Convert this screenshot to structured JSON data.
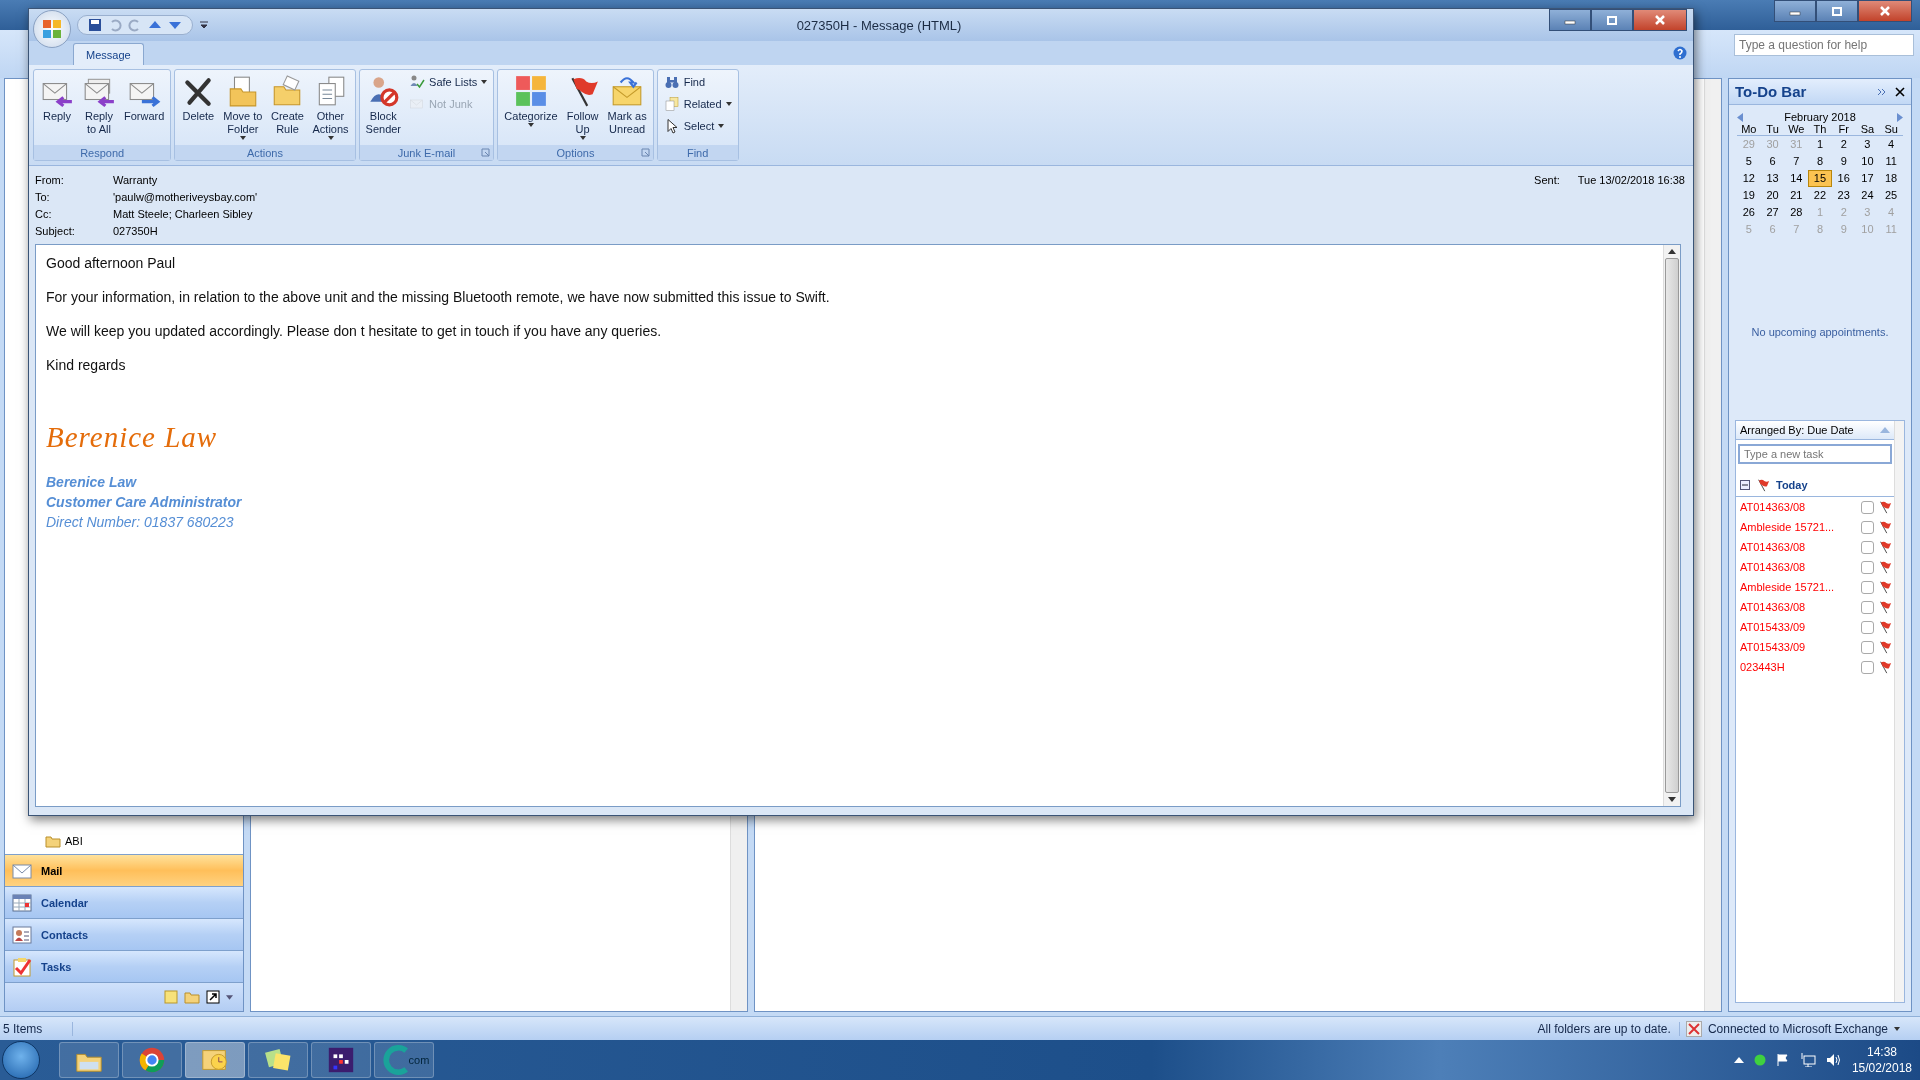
{
  "outlook": {
    "help_field": {
      "placeholder": "Type a question for help"
    }
  },
  "folders": [
    {
      "name": "ABI"
    }
  ],
  "nav": [
    {
      "label": "Mail",
      "selected": true
    },
    {
      "label": "Calendar",
      "selected": false
    },
    {
      "label": "Contacts",
      "selected": false
    },
    {
      "label": "Tasks",
      "selected": false
    }
  ],
  "todo": {
    "title": "To-Do Bar",
    "calendar": {
      "month": "February 2018",
      "weekdays": [
        "Mo",
        "Tu",
        "We",
        "Th",
        "Fr",
        "Sa",
        "Su"
      ],
      "weeks": [
        [
          {
            "day": "29",
            "muted": true,
            "selected": false
          },
          {
            "day": "30",
            "muted": true,
            "selected": false
          },
          {
            "day": "31",
            "muted": true,
            "selected": false
          },
          {
            "day": "1",
            "muted": false,
            "selected": false
          },
          {
            "day": "2",
            "muted": false,
            "selected": false
          },
          {
            "day": "3",
            "muted": false,
            "selected": false
          },
          {
            "day": "4",
            "muted": false,
            "selected": false
          }
        ],
        [
          {
            "day": "5",
            "muted": false,
            "selected": false
          },
          {
            "day": "6",
            "muted": false,
            "selected": false
          },
          {
            "day": "7",
            "muted": false,
            "selected": false
          },
          {
            "day": "8",
            "muted": false,
            "selected": false
          },
          {
            "day": "9",
            "muted": false,
            "selected": false
          },
          {
            "day": "10",
            "muted": false,
            "selected": false
          },
          {
            "day": "11",
            "muted": false,
            "selected": false
          }
        ],
        [
          {
            "day": "12",
            "muted": false,
            "selected": false
          },
          {
            "day": "13",
            "muted": false,
            "selected": false
          },
          {
            "day": "14",
            "muted": false,
            "selected": false
          },
          {
            "day": "15",
            "muted": false,
            "selected": true
          },
          {
            "day": "16",
            "muted": false,
            "selected": false
          },
          {
            "day": "17",
            "muted": false,
            "selected": false
          },
          {
            "day": "18",
            "muted": false,
            "selected": false
          }
        ],
        [
          {
            "day": "19",
            "muted": false,
            "selected": false
          },
          {
            "day": "20",
            "muted": false,
            "selected": false
          },
          {
            "day": "21",
            "muted": false,
            "selected": false
          },
          {
            "day": "22",
            "muted": false,
            "selected": false
          },
          {
            "day": "23",
            "muted": false,
            "selected": false
          },
          {
            "day": "24",
            "muted": false,
            "selected": false
          },
          {
            "day": "25",
            "muted": false,
            "selected": false
          }
        ],
        [
          {
            "day": "26",
            "muted": false,
            "selected": false
          },
          {
            "day": "27",
            "muted": false,
            "selected": false
          },
          {
            "day": "28",
            "muted": false,
            "selected": false
          },
          {
            "day": "1",
            "muted": true,
            "selected": false
          },
          {
            "day": "2",
            "muted": true,
            "selected": false
          },
          {
            "day": "3",
            "muted": true,
            "selected": false
          },
          {
            "day": "4",
            "muted": true,
            "selected": false
          }
        ],
        [
          {
            "day": "5",
            "muted": true,
            "selected": false
          },
          {
            "day": "6",
            "muted": true,
            "selected": false
          },
          {
            "day": "7",
            "muted": true,
            "selected": false
          },
          {
            "day": "8",
            "muted": true,
            "selected": false
          },
          {
            "day": "9",
            "muted": true,
            "selected": false
          },
          {
            "day": "10",
            "muted": true,
            "selected": false
          },
          {
            "day": "11",
            "muted": true,
            "selected": false
          }
        ]
      ]
    },
    "appointments_note": "No upcoming appointments.",
    "tasks": {
      "arranged_by": "Arranged By: Due Date",
      "new_task": {
        "placeholder": "Type a new task"
      },
      "group": "Today",
      "items": [
        {
          "title": "AT014363/08",
          "checked": false
        },
        {
          "title": "Ambleside 15721...",
          "checked": false
        },
        {
          "title": "AT014363/08",
          "checked": false
        },
        {
          "title": "AT014363/08",
          "checked": false
        },
        {
          "title": "Ambleside 15721...",
          "checked": false
        },
        {
          "title": "AT014363/08",
          "checked": false
        },
        {
          "title": "AT015433/09",
          "checked": false
        },
        {
          "title": "AT015433/09",
          "checked": false
        },
        {
          "title": "023443H",
          "checked": false
        }
      ]
    }
  },
  "status_bar": {
    "items": "5 Items",
    "sync": "All folders are up to date.",
    "connection": "Connected to Microsoft Exchange"
  },
  "taskbar": {
    "apps": [
      {
        "selected": false
      },
      {
        "selected": false
      },
      {
        "selected": true
      },
      {
        "selected": false
      },
      {
        "selected": false
      },
      {
        "selected": false,
        "logo_text": "com"
      }
    ],
    "clock": {
      "time": "14:38",
      "date": "15/02/2018"
    }
  },
  "message": {
    "title": "027350H - Message (HTML)",
    "tabs": [
      {
        "label": "Message",
        "selected": true
      }
    ],
    "ribbon": [
      {
        "label": "Respond",
        "launcher": false,
        "buttons": [
          {
            "kind": "large",
            "lines": [
              "Reply"
            ],
            "dropdown": false,
            "disabled": false
          },
          {
            "kind": "large",
            "lines": [
              "Reply",
              "to All"
            ],
            "dropdown": false,
            "disabled": false
          },
          {
            "kind": "large",
            "lines": [
              "Forward"
            ],
            "dropdown": false,
            "disabled": false
          }
        ]
      },
      {
        "label": "Actions",
        "launcher": false,
        "buttons": [
          {
            "kind": "large",
            "lines": [
              "Delete"
            ],
            "dropdown": false,
            "disabled": false
          },
          {
            "kind": "large",
            "lines": [
              "Move to",
              "Folder"
            ],
            "dropdown": true,
            "disabled": false
          },
          {
            "kind": "large",
            "lines": [
              "Create",
              "Rule"
            ],
            "dropdown": false,
            "disabled": false
          },
          {
            "kind": "large",
            "lines": [
              "Other",
              "Actions"
            ],
            "dropdown": true,
            "disabled": false
          }
        ]
      },
      {
        "label": "Junk E-mail",
        "launcher": true,
        "buttons": [
          {
            "kind": "large",
            "lines": [
              "Block",
              "Sender"
            ],
            "dropdown": false,
            "disabled": false
          },
          {
            "kind": "small",
            "lines": [
              "Safe Lists"
            ],
            "dropdown": true,
            "disabled": false
          },
          {
            "kind": "small",
            "lines": [
              "Not Junk"
            ],
            "dropdown": false,
            "disabled": true
          }
        ]
      },
      {
        "label": "Options",
        "launcher": true,
        "buttons": [
          {
            "kind": "large",
            "lines": [
              "Categorize"
            ],
            "dropdown": true,
            "disabled": false
          },
          {
            "kind": "large",
            "lines": [
              "Follow",
              "Up"
            ],
            "dropdown": true,
            "disabled": false
          },
          {
            "kind": "large",
            "lines": [
              "Mark as",
              "Unread"
            ],
            "dropdown": false,
            "disabled": false
          }
        ]
      },
      {
        "label": "Find",
        "launcher": false,
        "buttons": [
          {
            "kind": "small",
            "lines": [
              "Find"
            ],
            "dropdown": false,
            "disabled": false
          },
          {
            "kind": "small",
            "lines": [
              "Related"
            ],
            "dropdown": true,
            "disabled": false
          },
          {
            "kind": "small",
            "lines": [
              "Select"
            ],
            "dropdown": true,
            "disabled": false
          }
        ]
      }
    ],
    "header": {
      "fields": [
        {
          "label": "From:",
          "value": "Warranty"
        },
        {
          "label": "To:",
          "value": "'paulw@motheriveysbay.com'"
        },
        {
          "label": "Cc:",
          "value": "Matt Steele; Charleen Sibley"
        },
        {
          "label": "Subject:",
          "value": "027350H"
        }
      ],
      "sent": {
        "label": "Sent:",
        "value": "Tue 13/02/2018 16:38"
      }
    },
    "body": {
      "paragraphs": [
        "Good afternoon Paul",
        "For your information, in relation to the above unit and the missing Bluetooth remote,  we have now submitted this issue to Swift.",
        "We will keep you updated accordingly.  Please don t hesitate to get in touch if you have any queries.",
        "Kind regards"
      ],
      "signature": {
        "script_name": "Berenice Law",
        "name": "Berenice Law",
        "role": "Customer Care Administrator",
        "phone": "Direct Number: 01837 680223"
      }
    }
  }
}
